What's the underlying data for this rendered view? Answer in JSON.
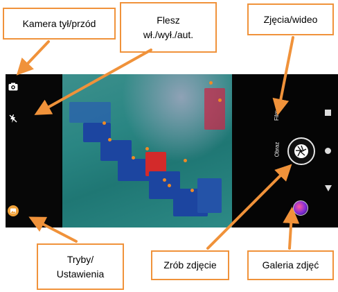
{
  "callouts": {
    "camera_switch": "Kamera tył/przód",
    "flash_line1": "Flesz",
    "flash_line2": "wł./wył./aut.",
    "photo_video": "Zjęcia/wideo",
    "modes_line1": "Tryby/",
    "modes_line2": "Ustawienia",
    "shutter": "Zrób zdjęcie",
    "gallery": "Galeria zdjęć"
  },
  "camera_ui": {
    "mode_film": "Film",
    "mode_photo": "Obraz"
  },
  "colors": {
    "callout_border": "#f0923a",
    "arrow": "#f0923a",
    "camera_background": "#000000"
  },
  "icons": {
    "camera_switch": "camera-switch-icon",
    "flash": "flash-off-icon",
    "modes": "image-modes-icon",
    "nav_square": "recent-apps-icon",
    "nav_circle": "home-icon",
    "nav_triangle": "back-icon"
  }
}
